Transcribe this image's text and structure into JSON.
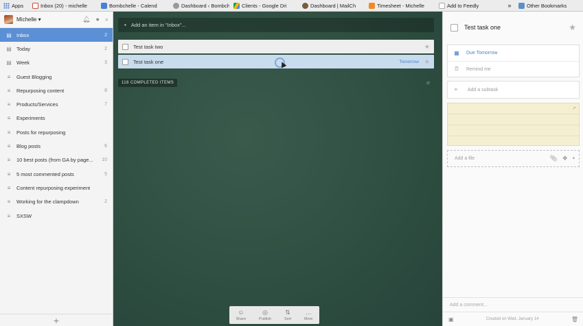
{
  "bookmarks": [
    {
      "label": "Apps",
      "icon": "apps-grid-icon",
      "color": "#4d7fd6"
    },
    {
      "label": "Inbox (20) - michelle",
      "icon": "gmail-icon",
      "color": "#d44638"
    },
    {
      "label": "Bombchelle - Calend",
      "icon": "calendar-icon",
      "color": "#4a7fd6"
    },
    {
      "label": "Dashboard ‹ Bombch",
      "icon": "wordpress-icon",
      "color": "#888888"
    },
    {
      "label": "Clients - Google Dri",
      "icon": "google-drive-icon",
      "color": "#f4b400"
    },
    {
      "label": "Dashboard | MailCh",
      "icon": "mailchimp-icon",
      "color": "#7a5c3b"
    },
    {
      "label": "Timesheet - Michelle",
      "icon": "timesheet-icon",
      "color": "#f08a24"
    },
    {
      "label": "Add to Feedly",
      "icon": "page-icon",
      "color": "#ffffff"
    },
    {
      "label": "»",
      "icon": "",
      "color": ""
    },
    {
      "label": "Other Bookmarks",
      "icon": "folder-icon",
      "color": "#5f8fc9"
    }
  ],
  "sidebar": {
    "user": "Michelle ▾",
    "lists": [
      {
        "label": "Inbox",
        "count": "2",
        "icon": "inbox-icon",
        "active": true
      },
      {
        "label": "Today",
        "count": "2",
        "icon": "today-icon"
      },
      {
        "label": "Week",
        "count": "3",
        "icon": "week-icon"
      },
      {
        "label": "Guest Blogging",
        "count": "",
        "icon": "list-icon"
      },
      {
        "label": "Repurposing content",
        "count": "8",
        "icon": "list-icon"
      },
      {
        "label": "Products/Services",
        "count": "7",
        "icon": "list-icon"
      },
      {
        "label": "Experiments",
        "count": "",
        "icon": "list-icon"
      },
      {
        "label": "Posts for repurposing",
        "count": "",
        "icon": "list-icon"
      },
      {
        "label": "Blog posts",
        "count": "6",
        "icon": "list-icon"
      },
      {
        "label": "10 best posts (from GA by page...",
        "count": "10",
        "icon": "list-icon"
      },
      {
        "label": "5 most commented posts",
        "count": "5",
        "icon": "list-icon"
      },
      {
        "label": "Content repurposing experiment",
        "count": "",
        "icon": "list-icon"
      },
      {
        "label": "Working for the clampdown",
        "count": "2",
        "icon": "list-icon"
      },
      {
        "label": "SXSW",
        "count": "",
        "icon": "list-icon"
      }
    ],
    "add_symbol": "+"
  },
  "main": {
    "add_placeholder": "Add an item in \"Inbox\"...",
    "tasks": [
      {
        "title": "Test task two",
        "due": ""
      },
      {
        "title": "Test task one",
        "due": "Tomorrow"
      }
    ],
    "completed_label": "118 COMPLETED ITEMS",
    "toolbar": [
      {
        "label": "Share",
        "icon": "share-icon"
      },
      {
        "label": "Publish",
        "icon": "publish-icon"
      },
      {
        "label": "Sort",
        "icon": "sort-icon"
      },
      {
        "label": "More",
        "icon": "more-icon"
      }
    ]
  },
  "detail": {
    "title": "Test task one",
    "due": "Due Tomorrow",
    "remind": "Remind me",
    "subtask_placeholder": "Add a subtask",
    "file_placeholder": "Add a file",
    "comment_placeholder": "Add a comment...",
    "created": "Created on Wed, January 14"
  },
  "colors": {
    "accent": "#5b8fd6",
    "background": "#2f4f42",
    "due_blue": "#4a80c8",
    "note_yellow": "#f5efd2"
  }
}
